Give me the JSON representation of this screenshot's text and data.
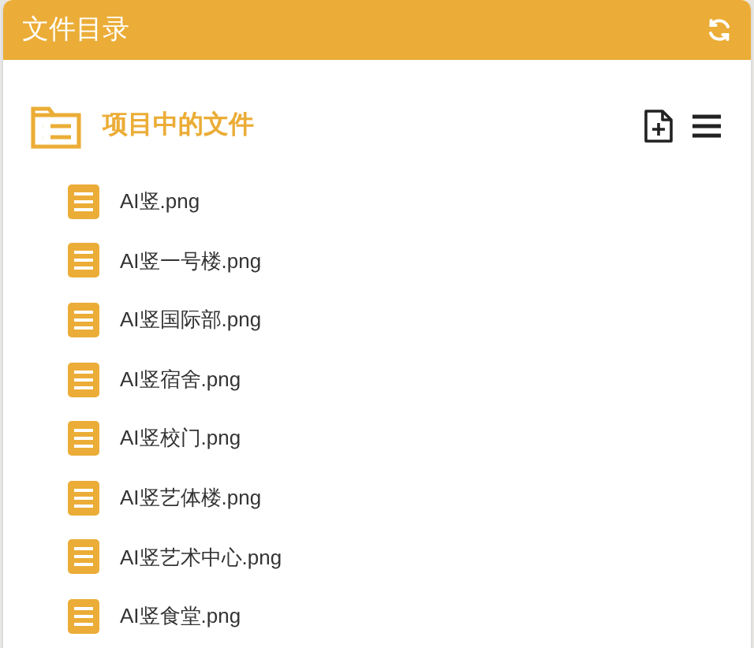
{
  "panel": {
    "title": "文件目录"
  },
  "section": {
    "title": "项目中的文件"
  },
  "files": [
    {
      "name": "AI竖.png"
    },
    {
      "name": "AI竖一号楼.png"
    },
    {
      "name": "AI竖国际部.png"
    },
    {
      "name": "AI竖宿舍.png"
    },
    {
      "name": "AI竖校门.png"
    },
    {
      "name": "AI竖艺体楼.png"
    },
    {
      "name": "AI竖艺术中心.png"
    },
    {
      "name": "AI竖食堂.png"
    }
  ]
}
